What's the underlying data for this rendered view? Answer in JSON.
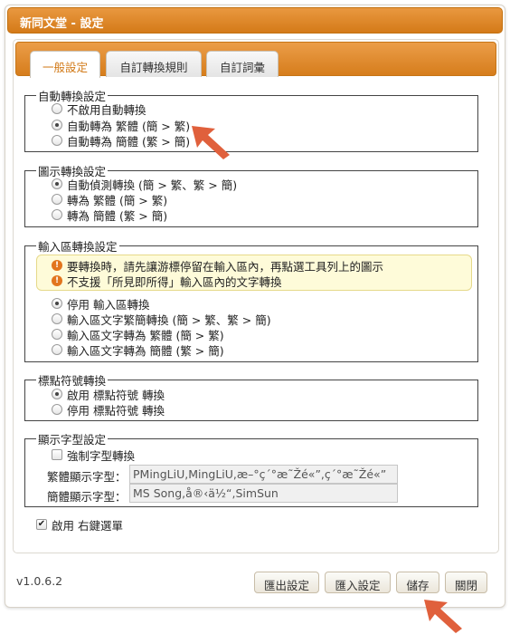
{
  "window": {
    "title": "新同文堂 - 設定"
  },
  "tabs": [
    {
      "label": "一般設定",
      "active": true
    },
    {
      "label": "自訂轉換規則",
      "active": false
    },
    {
      "label": "自訂詞彙",
      "active": false
    }
  ],
  "auto_convert": {
    "legend": "自動轉換設定",
    "options": [
      {
        "label": "不啟用自動轉換",
        "checked": false
      },
      {
        "label": "自動轉為 繁體 (簡 > 繁)",
        "checked": true
      },
      {
        "label": "自動轉為 簡體 (繁 > 簡)",
        "checked": false
      }
    ]
  },
  "image_convert": {
    "legend": "圖示轉換設定",
    "options": [
      {
        "label": "自動偵測轉換 (簡 > 繁、繁 > 簡)",
        "checked": true
      },
      {
        "label": "轉為 繁體 (簡 > 繁)",
        "checked": false
      },
      {
        "label": "轉為 簡體 (繁 > 簡)",
        "checked": false
      }
    ]
  },
  "input_convert": {
    "legend": "輸入區轉換設定",
    "notices": [
      "要轉換時，請先讓游標停留在輸入區內，再點選工具列上的圖示",
      "不支援「所見即所得」輸入區內的文字轉換"
    ],
    "options": [
      {
        "label": "停用 輸入區轉換",
        "checked": true
      },
      {
        "label": "輸入區文字繁簡轉換 (簡 > 繁、繁 > 簡)",
        "checked": false
      },
      {
        "label": "輸入區文字轉為 繁體 (簡 > 繁)",
        "checked": false
      },
      {
        "label": "輸入區文字轉為 簡體 (繁 > 簡)",
        "checked": false
      }
    ]
  },
  "punctuation": {
    "legend": "標點符號轉換",
    "options": [
      {
        "label": "啟用 標點符號 轉換",
        "checked": true
      },
      {
        "label": "停用 標點符號 轉換",
        "checked": false
      }
    ]
  },
  "display_font": {
    "legend": "顯示字型設定",
    "force_label": "強制字型轉換",
    "force_checked": false,
    "traditional_label": "繁體顯示字型：",
    "traditional_value": "PMingLiU,MingLiU,æ–°ç´°æ˜Žé«”,ç´°æ˜Žé«”",
    "simplified_label": "簡體顯示字型：",
    "simplified_value": "MS Song,å®‹ä½“,SimSun"
  },
  "context_menu": {
    "label": "啟用 右鍵選單",
    "checked": true
  },
  "footer": {
    "version": "v1.0.6.2",
    "buttons": [
      "匯出設定",
      "匯入設定",
      "儲存",
      "關閉"
    ]
  },
  "colors": {
    "accent": "#d67d1c",
    "arrow": "#e0603c"
  }
}
